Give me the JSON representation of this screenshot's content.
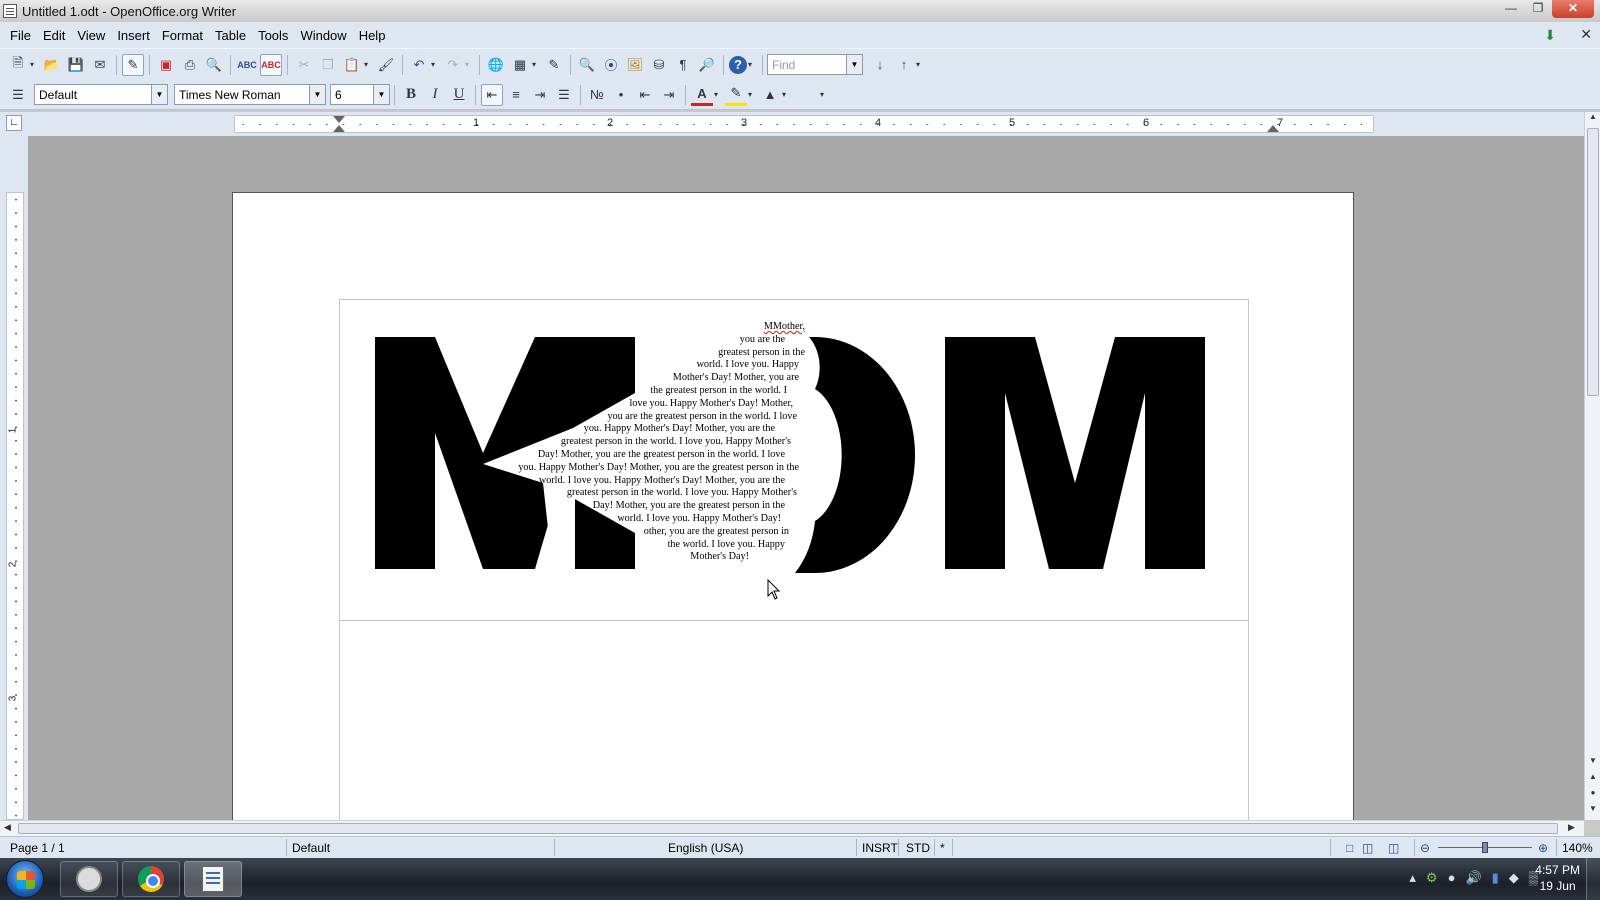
{
  "window": {
    "title": "Untitled 1.odt - OpenOffice.org Writer"
  },
  "menu": [
    "File",
    "Edit",
    "View",
    "Insert",
    "Format",
    "Table",
    "Tools",
    "Window",
    "Help"
  ],
  "toolbar": {
    "find_placeholder": "Find",
    "style_value": "Default",
    "font_value": "Times New Roman",
    "size_value": "6"
  },
  "ruler": {
    "h_numbers": [
      "1",
      "2",
      "3",
      "4",
      "5",
      "6",
      "7"
    ],
    "v_numbers": [
      "1",
      "2",
      "3"
    ]
  },
  "document": {
    "poem_lines": [
      "MMother,",
      "you are the",
      "greatest person in the",
      "world. I love you. Happy",
      "Mother's Day! Mother, you are",
      "the greatest person in the world. I",
      "love you. Happy Mother's Day! Mother,",
      "you are the greatest person in the world. I love",
      "you. Happy Mother's Day! Mother, you are the",
      "greatest person in the world. I love you. Happy Mother's",
      "Day! Mother, you are the greatest person in the world. I love",
      "you. Happy Mother's Day! Mother, you are the greatest person in the",
      "world. I love you. Happy Mother's Day! Mother, you are the",
      "greatest person in the world. I love you. Happy Mother's",
      "Day! Mother, you are the greatest person in the",
      "world. I love you. Happy Mother's Day!",
      "other, you are the greatest person in",
      "the world. I love you. Happy",
      "Mother's Day!"
    ]
  },
  "status": {
    "page": "Page 1 / 1",
    "style": "Default",
    "language": "English (USA)",
    "insert_mode": "INSRT",
    "selection_mode": "STD",
    "modified": "*",
    "zoom": "140%"
  },
  "taskbar": {
    "time": "4:57 PM",
    "date": "19 Jun"
  }
}
